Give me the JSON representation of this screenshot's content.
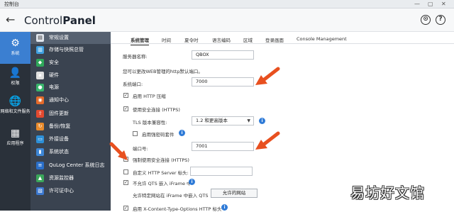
{
  "window": {
    "title": "控制台"
  },
  "header": {
    "back_symbol": "←",
    "brand_normal": "Control",
    "brand_bold": "Panel",
    "search_symbol": "⊙",
    "help_symbol": "?"
  },
  "leftnav": [
    {
      "name": "system",
      "label": "系统",
      "icon": "gear-icon",
      "glyph": "⚙"
    },
    {
      "name": "privilege",
      "label": "权限",
      "icon": "user-icon",
      "glyph": "👤"
    },
    {
      "name": "network",
      "label": "网络和文件服务",
      "icon": "globe-icon",
      "glyph": "🌐"
    },
    {
      "name": "apps",
      "label": "应用程序",
      "icon": "grid-icon",
      "glyph": "▦"
    }
  ],
  "submenu": [
    {
      "label": "常规设置",
      "color": "#e1e6ed",
      "glyph": "▤"
    },
    {
      "label": "存储与快照总管",
      "color": "#3fa0e0",
      "glyph": "▥"
    },
    {
      "label": "安全",
      "color": "#2fa85a",
      "glyph": "◆"
    },
    {
      "label": "硬件",
      "color": "#e0e0e0",
      "glyph": "▪"
    },
    {
      "label": "电源",
      "color": "#38b46c",
      "glyph": "●"
    },
    {
      "label": "通知中心",
      "color": "#e46a2a",
      "glyph": "◉"
    },
    {
      "label": "固件更新",
      "color": "#e2492f",
      "glyph": "⇪"
    },
    {
      "label": "备份/恢复",
      "color": "#e88b2c",
      "glyph": "↻"
    },
    {
      "label": "外接设备",
      "color": "#2c8fd8",
      "glyph": "▭"
    },
    {
      "label": "系统状态",
      "color": "#3d86d6",
      "glyph": "▮"
    },
    {
      "label": "QuLog Center 系统日志",
      "color": "#2a6fc9",
      "glyph": "≡"
    },
    {
      "label": "资源监控器",
      "color": "#3aa65a",
      "glyph": "▲"
    },
    {
      "label": "许可证中心",
      "color": "#3b78d0",
      "glyph": "▧"
    }
  ],
  "tabs": [
    "系统管理",
    "时间",
    "夏令时",
    "语言编码",
    "区域",
    "登录画面",
    "Console Management"
  ],
  "form": {
    "server_name_label": "服务器名称:",
    "server_name_value": "QBOX",
    "port_hint": "您可以更改WEB管理的http默认端口。",
    "system_port_label": "系统端口:",
    "system_port_value": "7000",
    "enable_http_compression": "启用 HTTP 压缩",
    "enable_https": "使用安全连接 (HTTPS)",
    "tls_label": "TLS 版本兼容性:",
    "tls_value": "1.2 和更高版本",
    "enable_strong_cipher": "启用强密码套件",
    "port_no_label": "端口号:",
    "port_no_value": "7001",
    "force_https": "强制使用安全连接 (HTTPS)",
    "custom_header": "自定义 HTTP Server 标头:",
    "no_iframe": "不允许 QTS 嵌入 iFrame 中",
    "allow_iframe_label": "允许特定网站在 iFrame 中嵌入 QTS",
    "allowed_sites_button": "允许的网站",
    "x_content_type": "启用 X-Content-Type-Options HTTP 标头"
  },
  "watermark": "易坊好文馆",
  "colors": {
    "accent": "#3b7fd1",
    "arrow": "#e8501f",
    "nav_bg": "#2a313a",
    "submenu_bg": "#3a4350"
  }
}
